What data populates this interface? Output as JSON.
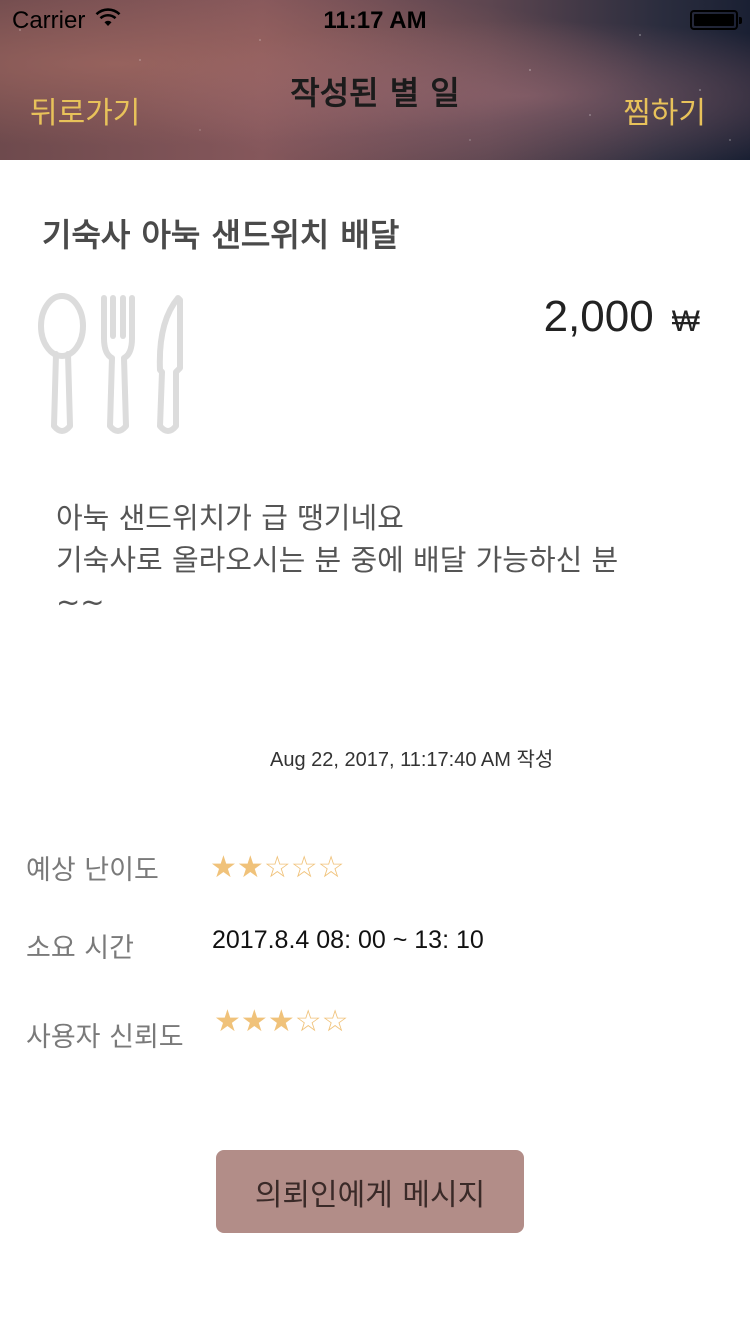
{
  "status_bar": {
    "carrier": "Carrier",
    "time": "11:17 AM"
  },
  "nav": {
    "back_label": "뒤로가기",
    "title": "작성된 별 일",
    "favorite_label": "찜하기"
  },
  "post": {
    "title": "기숙사 아눅 샌드위치 배달",
    "category_icon": "utensils-icon",
    "price": "2,000",
    "currency": "₩",
    "description": "아눅 샌드위치가 급 땡기네요\n기숙사로 올라오시는 분 중에 배달 가능하신 분\n~~",
    "timestamp": "Aug 22, 2017, 11:17:40 AM 작성"
  },
  "details": {
    "difficulty_label": "예상 난이도",
    "difficulty_rating": 2,
    "difficulty_max": 5,
    "time_label": "소요 시간",
    "time_value": "2017.8.4 08: 00 ~  13: 10",
    "trust_label": "사용자 신뢰도",
    "trust_rating": 3,
    "trust_max": 5
  },
  "actions": {
    "message_button_label": "의뢰인에게 메시지"
  },
  "colors": {
    "accent_gold": "#e8c25a",
    "star_color": "#f0c27a",
    "button_bg": "#b28d88"
  }
}
